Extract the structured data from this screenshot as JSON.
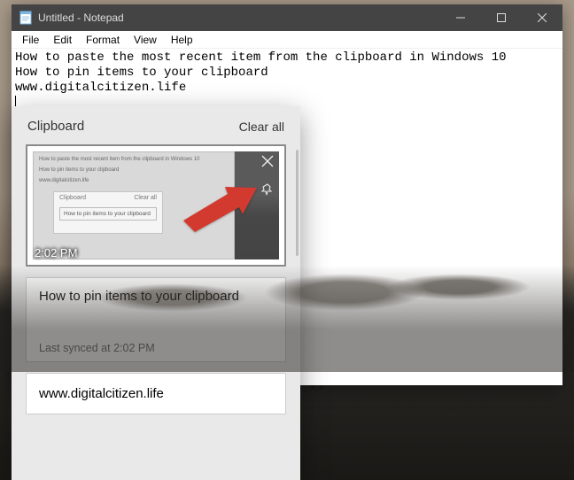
{
  "window": {
    "title": "Untitled - Notepad",
    "menus": [
      "File",
      "Edit",
      "Format",
      "View",
      "Help"
    ]
  },
  "document_text": "How to paste the most recent item from the clipboard in Windows 10\nHow to pin items to your clipboard\nwww.digitalcitizen.life",
  "clipboard": {
    "title": "Clipboard",
    "clear_label": "Clear all",
    "items": [
      {
        "type": "image",
        "timestamp": "2:02 PM",
        "thumb_lines": [
          "How to paste the most recent item from the clipboard in Windows 10",
          "How to pin items to your clipboard",
          "www.digitalcitizen.life"
        ],
        "thumb_popup_title": "Clipboard",
        "thumb_popup_clear": "Clear all",
        "thumb_popup_row": "How to pin items to your clipboard",
        "selected": true
      },
      {
        "type": "text",
        "text": "How to pin items to your clipboard",
        "synced_label": "Last synced at 2:02 PM"
      },
      {
        "type": "text",
        "text": "www.digitalcitizen.life"
      }
    ]
  }
}
